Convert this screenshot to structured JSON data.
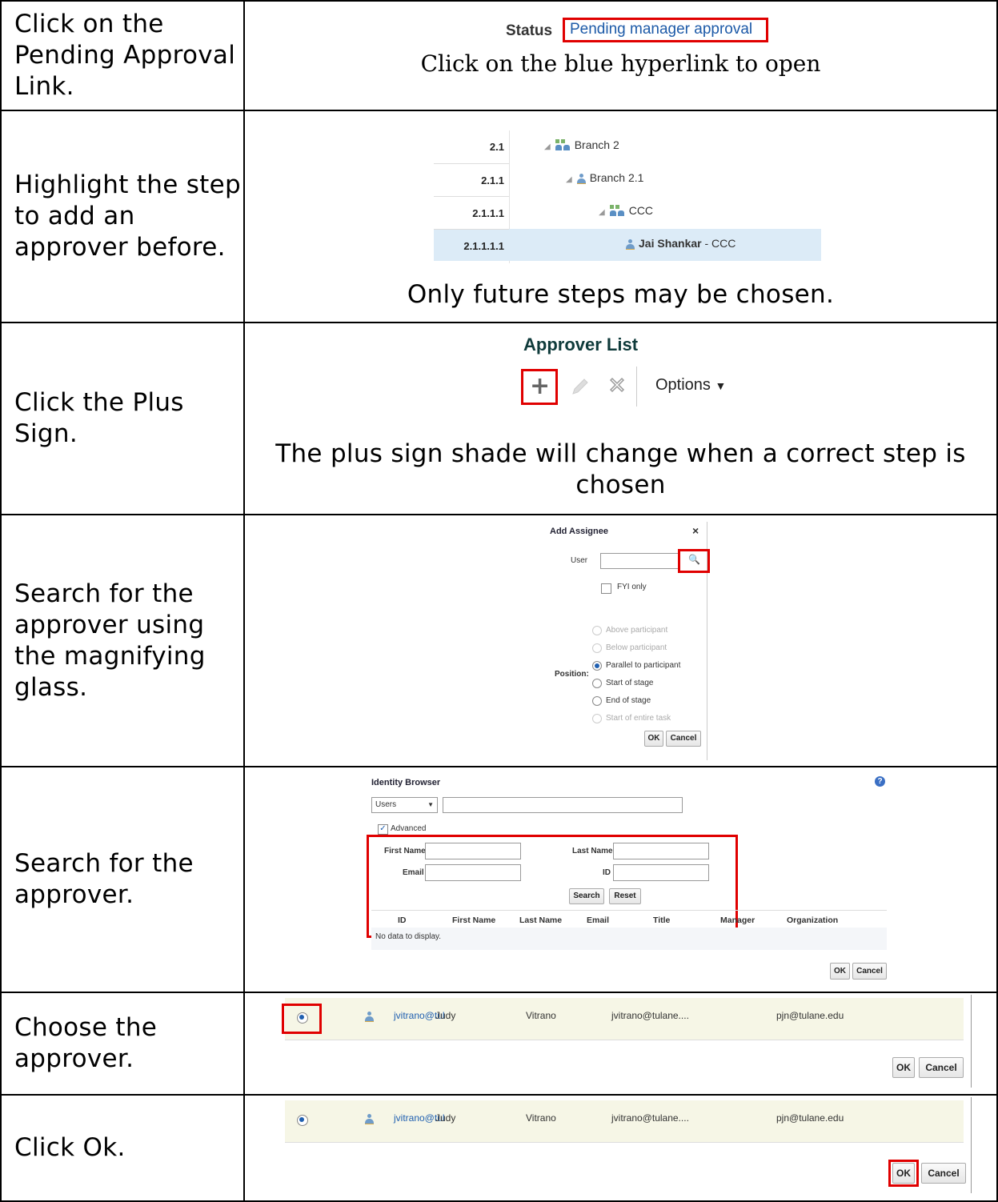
{
  "steps": [
    {
      "instruction": "Click on the Pending Approval Link.",
      "caption": "Click on the blue hyperlink to open"
    },
    {
      "instruction": "Highlight the step to add an approver before.",
      "caption": "Only future steps may be chosen."
    },
    {
      "instruction": "Click the Plus Sign.",
      "caption": "The plus sign shade will change when a correct step is chosen"
    },
    {
      "instruction": "Search for the approver using the magnifying glass."
    },
    {
      "instruction": "Search for the approver."
    },
    {
      "instruction": "Choose the approver."
    },
    {
      "instruction": "Click Ok."
    }
  ],
  "status": {
    "label": "Status",
    "link": "Pending manager approval"
  },
  "tree": [
    {
      "num": "2.1",
      "label": "Branch 2",
      "icon": "group-icon"
    },
    {
      "num": "2.1.1",
      "label": "Branch 2.1",
      "icon": "person-icon"
    },
    {
      "num": "2.1.1.1",
      "label": "CCC",
      "icon": "group-icon"
    },
    {
      "num": "2.1.1.1.1",
      "label_bold": "Jai Shankar",
      "label_rest": " - CCC",
      "icon": "person-icon",
      "selected": true
    }
  ],
  "approver_list": {
    "title": "Approver List",
    "options": "Options"
  },
  "add_assignee": {
    "title": "Add Assignee",
    "user_label": "User",
    "fyi_label": "FYI only",
    "position_label": "Position:",
    "positions": [
      {
        "label": "Above participant",
        "enabled": false,
        "selected": false
      },
      {
        "label": "Below participant",
        "enabled": false,
        "selected": false
      },
      {
        "label": "Parallel to participant",
        "enabled": true,
        "selected": true
      },
      {
        "label": "Start of stage",
        "enabled": true,
        "selected": false
      },
      {
        "label": "End of stage",
        "enabled": true,
        "selected": false
      },
      {
        "label": "Start of entire task",
        "enabled": false,
        "selected": false
      }
    ],
    "ok": "OK",
    "cancel": "Cancel"
  },
  "identity_browser": {
    "title": "Identity Browser",
    "type_select": "Users",
    "advanced": "Advanced",
    "first_name": "First Name",
    "last_name": "Last Name",
    "email": "Email",
    "id": "ID",
    "search": "Search",
    "reset": "Reset",
    "columns": [
      "ID",
      "First Name",
      "Last Name",
      "Email",
      "Title",
      "Manager",
      "Organization"
    ],
    "empty": "No data to display.",
    "ok": "OK",
    "cancel": "Cancel"
  },
  "result_row": {
    "id": "jvitrano@tul",
    "first": "Judy",
    "last": "Vitrano",
    "email": "jvitrano@tulane....",
    "manager": "pjn@tulane.edu"
  },
  "buttons": {
    "ok": "OK",
    "cancel": "Cancel"
  }
}
